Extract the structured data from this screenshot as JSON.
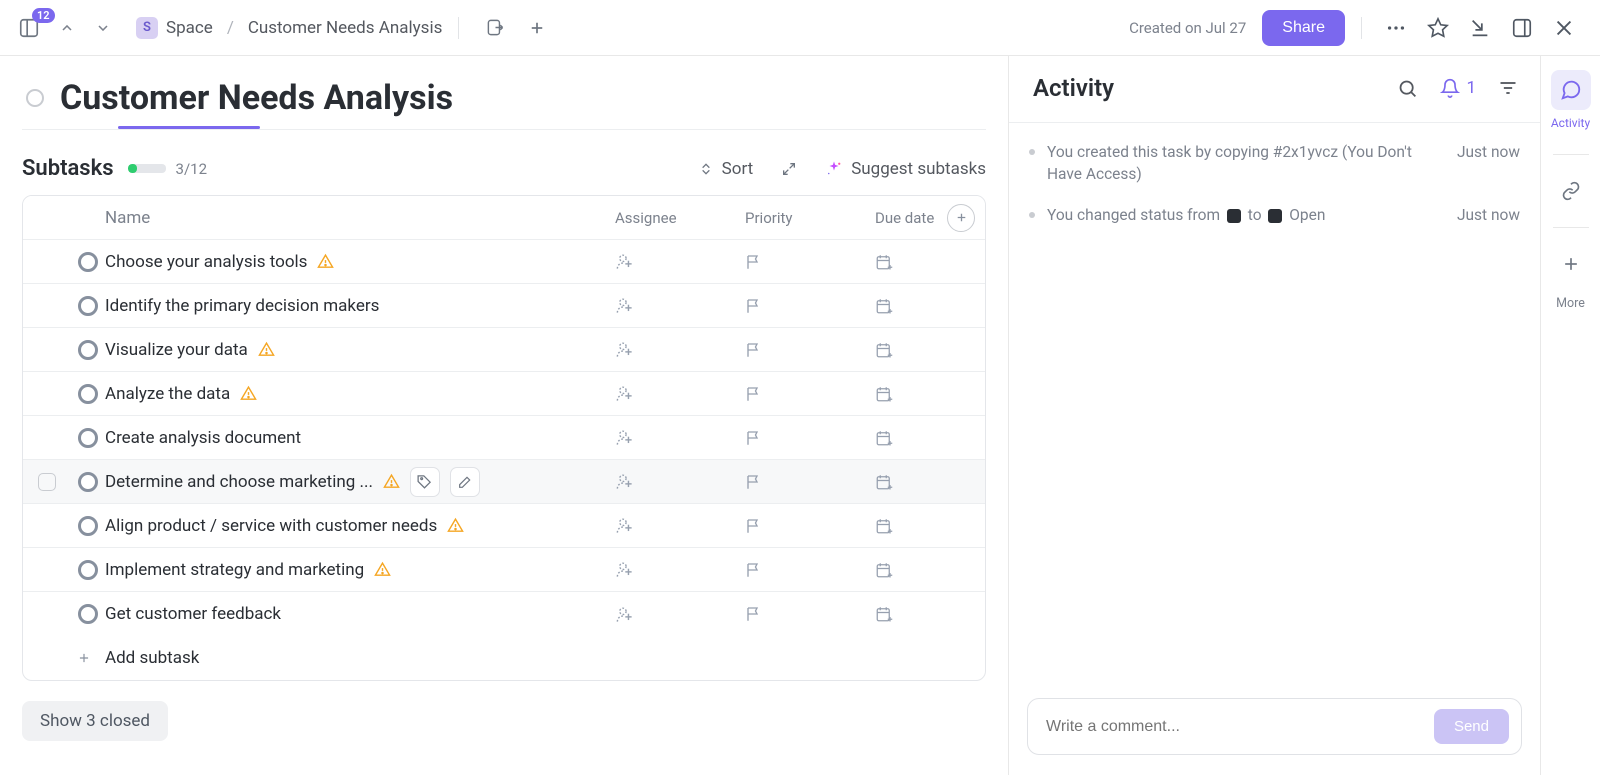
{
  "topbar": {
    "badge": "12",
    "space_letter": "S",
    "breadcrumb_space": "Space",
    "breadcrumb_sep": "/",
    "breadcrumb_current": "Customer Needs Analysis",
    "created_on": "Created on Jul 27",
    "share": "Share"
  },
  "page": {
    "title": "Customer Needs Analysis"
  },
  "subtasks": {
    "heading": "Subtasks",
    "progress_text": "3/12",
    "sort": "Sort",
    "suggest": "Suggest subtasks",
    "add_subtask": "Add subtask",
    "show_closed": "Show 3 closed",
    "columns": {
      "name": "Name",
      "assignee": "Assignee",
      "priority": "Priority",
      "due": "Due date"
    },
    "rows": [
      {
        "name": "Choose your analysis tools",
        "warn": true,
        "hover": false
      },
      {
        "name": "Identify the primary decision makers",
        "warn": false,
        "hover": false
      },
      {
        "name": "Visualize your data",
        "warn": true,
        "hover": false
      },
      {
        "name": "Analyze the data",
        "warn": true,
        "hover": false
      },
      {
        "name": "Create analysis document",
        "warn": false,
        "hover": false
      },
      {
        "name": "Determine and choose marketing ...",
        "warn": true,
        "hover": true
      },
      {
        "name": "Align product / service with customer needs",
        "warn": true,
        "hover": false
      },
      {
        "name": "Implement strategy and marketing",
        "warn": true,
        "hover": false
      },
      {
        "name": "Get customer feedback",
        "warn": false,
        "hover": false
      }
    ]
  },
  "activity": {
    "title": "Activity",
    "bell_count": "1",
    "items": [
      {
        "text_pre": "You created this task by copying #2x1yvcz (You Don't Have Access)",
        "time": "Just now",
        "status_change": false
      },
      {
        "text_pre": "You changed status from ",
        "text_mid": " to ",
        "text_post": " Open",
        "time": "Just now",
        "status_change": true
      }
    ],
    "comment_placeholder": "Write a comment...",
    "send": "Send"
  },
  "rail": {
    "activity_label": "Activity",
    "more": "More"
  }
}
